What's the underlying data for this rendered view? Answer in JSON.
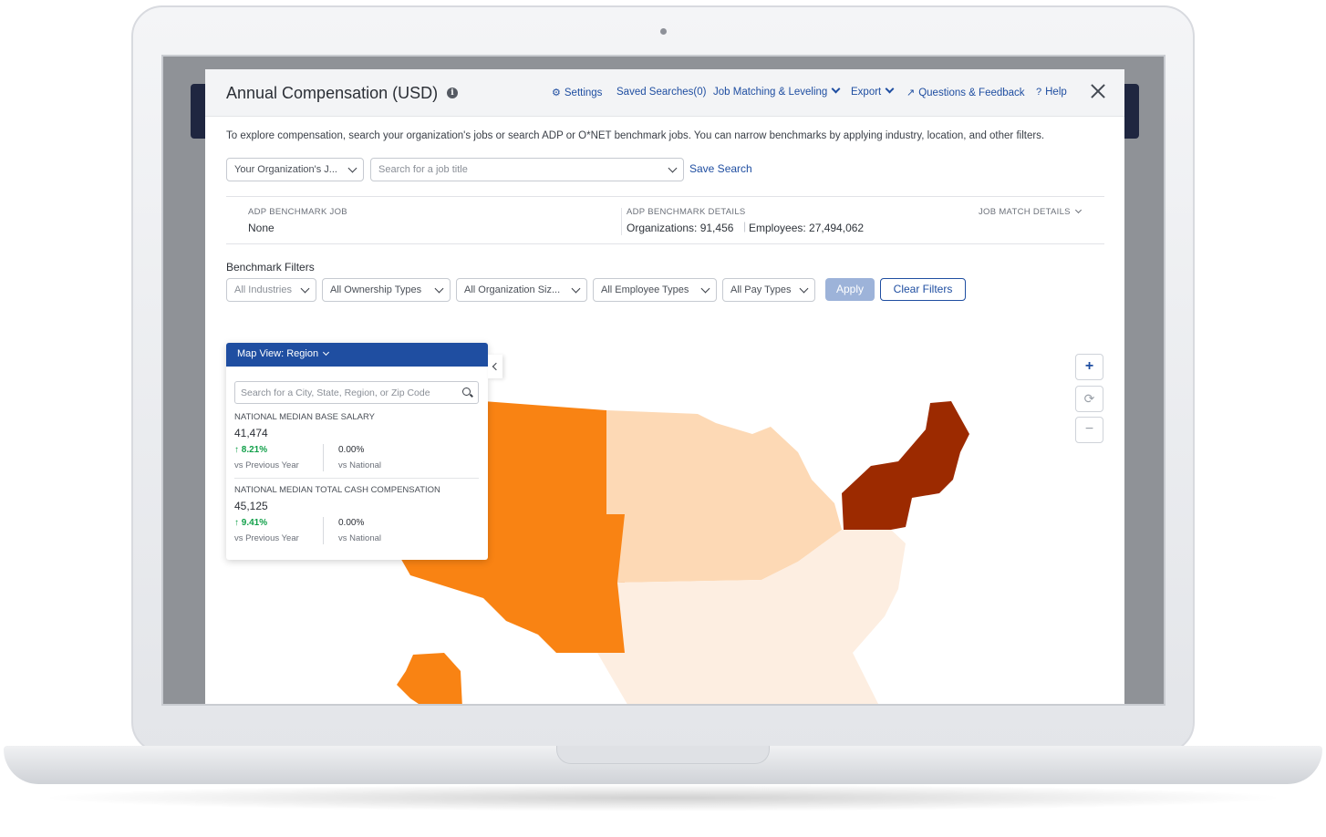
{
  "header": {
    "title": "Annual Compensation (USD)",
    "settings": "Settings",
    "saved_searches": "Saved Searches(0)",
    "job_matching": "Job Matching & Leveling",
    "export": "Export",
    "questions": "Questions & Feedback",
    "help": "Help"
  },
  "intro": "To explore compensation, search your organization's jobs or search ADP or O*NET benchmark jobs. You can narrow benchmarks by applying industry, location, and other filters.",
  "search": {
    "org_select": "Your Organization's J...",
    "job_placeholder": "Search for a job title",
    "save_search": "Save Search"
  },
  "benchmark": {
    "job_label": "ADP BENCHMARK JOB",
    "job_value": "None",
    "details_label": "ADP BENCHMARK DETAILS",
    "organizations": "Organizations: 91,456",
    "employees": "Employees: 27,494,062",
    "match_label": "JOB MATCH DETAILS"
  },
  "filters": {
    "title": "Benchmark Filters",
    "industries": "All Industries",
    "ownership": "All Ownership Types",
    "org_size": "All Organization Siz...",
    "employee_types": "All Employee Types",
    "pay_types": "All Pay Types",
    "apply": "Apply",
    "clear": "Clear Filters"
  },
  "map_panel": {
    "view_label": "Map View: Region",
    "search_placeholder": "Search for a City, State, Region, or Zip Code",
    "base_salary_label": "NATIONAL MEDIAN BASE SALARY",
    "base_salary_value": "41,474",
    "base_salary_change": "8.21%",
    "base_salary_vs_national": "0.00%",
    "cash_comp_label": "NATIONAL MEDIAN TOTAL CASH COMPENSATION",
    "cash_comp_value": "45,125",
    "cash_comp_change": "9.41%",
    "cash_comp_vs_national": "0.00%",
    "vs_previous": "vs Previous Year",
    "vs_national": "vs National"
  },
  "zoom": {
    "in": "+",
    "reset": "⟳",
    "out": "−"
  },
  "colors": {
    "accent": "#1f4ea1",
    "west": "#f98313",
    "midwest": "#fdd9b5",
    "northeast": "#9c2a00",
    "south": "#fdeee1",
    "positive": "#12a04a"
  }
}
